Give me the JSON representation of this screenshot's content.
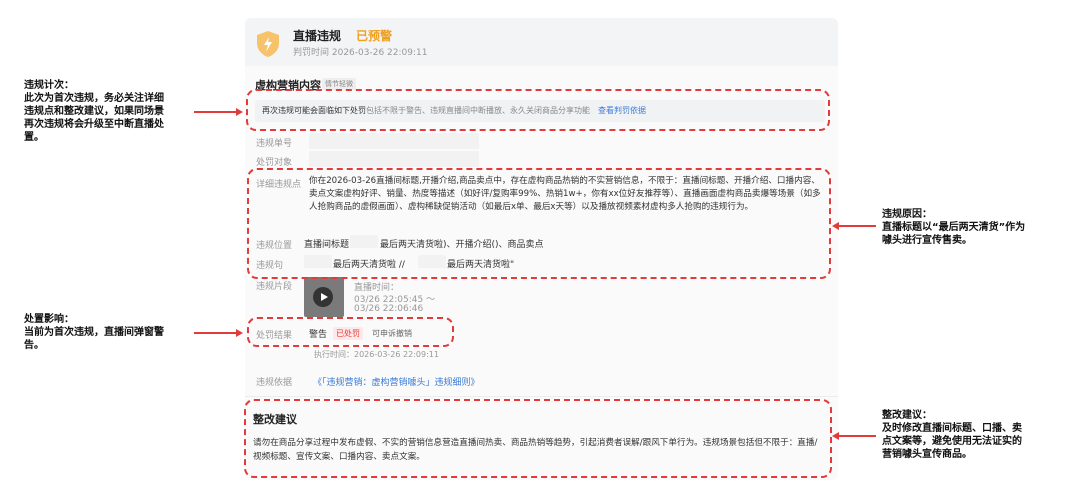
{
  "header": {
    "title": "直播违规",
    "status": "已预警",
    "time": "判罚时间 2026-03-26 22:09:11"
  },
  "section": {
    "title": "虚构营销内容",
    "tag": "情节轻微"
  },
  "notice": {
    "main": "再次违规可能会面临如下处罚",
    "sub": "包括不限于警告、违规直播间中断播放、永久关闭商品分享功能",
    "link": "查看判罚依据"
  },
  "fields": {
    "violation_no_label": "违规单号",
    "penalty_target_label": "处罚对象",
    "detail_label": "详细违规点",
    "detail_text": "你在2026-03-26直播间标题,开播介绍,商品卖点中，存在虚构商品热销的不实营销信息，不限于：直播间标题、开播介绍、口播内容、卖点文案虚构好评、销量、热度等描述（如好评/复购率99%、热销1w+，你有xx位好友推荐等）、直播画面虚构商品卖爆等场景（如多人抢购商品的虚假画面）、虚构稀缺促销活动（如最后x单、最后x天等）以及播放视频素材虚构多人抢购的违规行为。",
    "location_label": "违规位置",
    "location_a": "直播间标题",
    "location_b": "最后两天清货啦)、开播介绍()、商品卖点",
    "sentence_label": "违规句",
    "sentence_a": "最后两天清货啦 //",
    "sentence_b": "最后两天清货啦\"",
    "clip_label": "违规片段",
    "clip_time_label": "直播时间：",
    "clip_time_start": "03/26 22:05:45 ～",
    "clip_time_end": "03/26 22:06:46",
    "result_label": "处罚结果",
    "result_value": "警告",
    "result_status": "已处罚",
    "result_appeal": "可申诉撤销",
    "exec_time": "执行时间：2026-03-26 22:09:11",
    "basis_label": "违规依据",
    "basis_link": "《「违规营销：虚构营销噱头」违规细则》"
  },
  "suggestion": {
    "title": "整改建议",
    "text": "请勿在商品分享过程中发布虚假、不实的营销信息营造直播间热卖、商品热销等趋势，引起消费者误解/跟风下单行为。违规场景包括但不限于：直播/视频标题、宣传文案、口播内容、卖点文案。"
  },
  "annotations": {
    "count_title": "违规计次：",
    "count_text": [
      "此次为首次违规，务必关注详细",
      "违规点和整改建议，如果同场景",
      "再次违规将会升级至中断直播处",
      "置。"
    ],
    "reason_title": "违规原因：",
    "reason_text": [
      "直播标题以“最后两天清货”作为",
      "噱头进行宣传售卖。"
    ],
    "impact_title": "处置影响：",
    "impact_text": [
      "当前为首次违规，直播间弹窗警",
      "告。"
    ],
    "fix_title": "整改建议：",
    "fix_text": [
      "及时修改直播间标题、口播、卖",
      "点文案等，避免使用无法证实的",
      "营销噱头宣传商品。"
    ]
  },
  "colors": {
    "accent_red": "#e23b3b",
    "warn_orange": "#f0a020",
    "link_blue": "#3a7bd5"
  },
  "icons": {
    "shield": "shield-lightning-icon",
    "play": "play-icon"
  }
}
